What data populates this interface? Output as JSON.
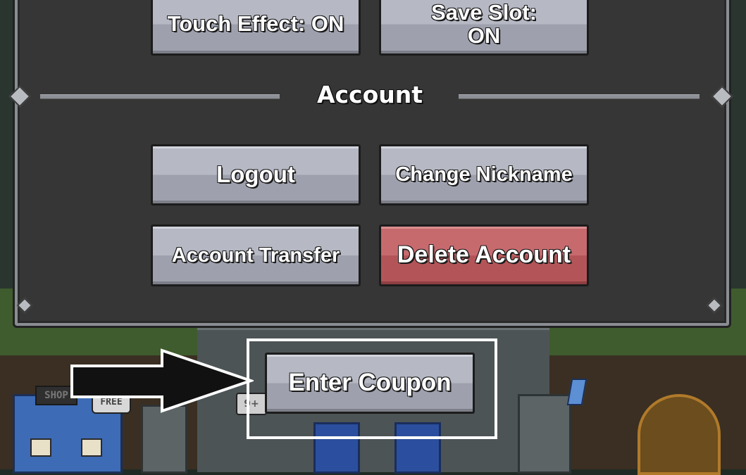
{
  "settings_panel": {
    "top_buttons": {
      "touch_effect": "Touch Effect: ON",
      "save_slot": "Save Slot:\nON"
    },
    "account_section": {
      "title": "Account",
      "logout": "Logout",
      "change_nickname": "Change Nickname",
      "account_transfer": "Account Transfer",
      "delete_account": "Delete Account"
    }
  },
  "coupon": {
    "enter_coupon": "Enter Coupon"
  },
  "background": {
    "shop_sign": "SHOP",
    "free_sign": "FREE",
    "badge_count": "9+"
  },
  "colors": {
    "panel_bg": "#363636",
    "button_gray": "#b6b9c4",
    "button_red": "#c76a6e",
    "highlight_outline": "#ffffff"
  },
  "icons": [
    "arrow-right-icon",
    "corner-gem-icon"
  ]
}
